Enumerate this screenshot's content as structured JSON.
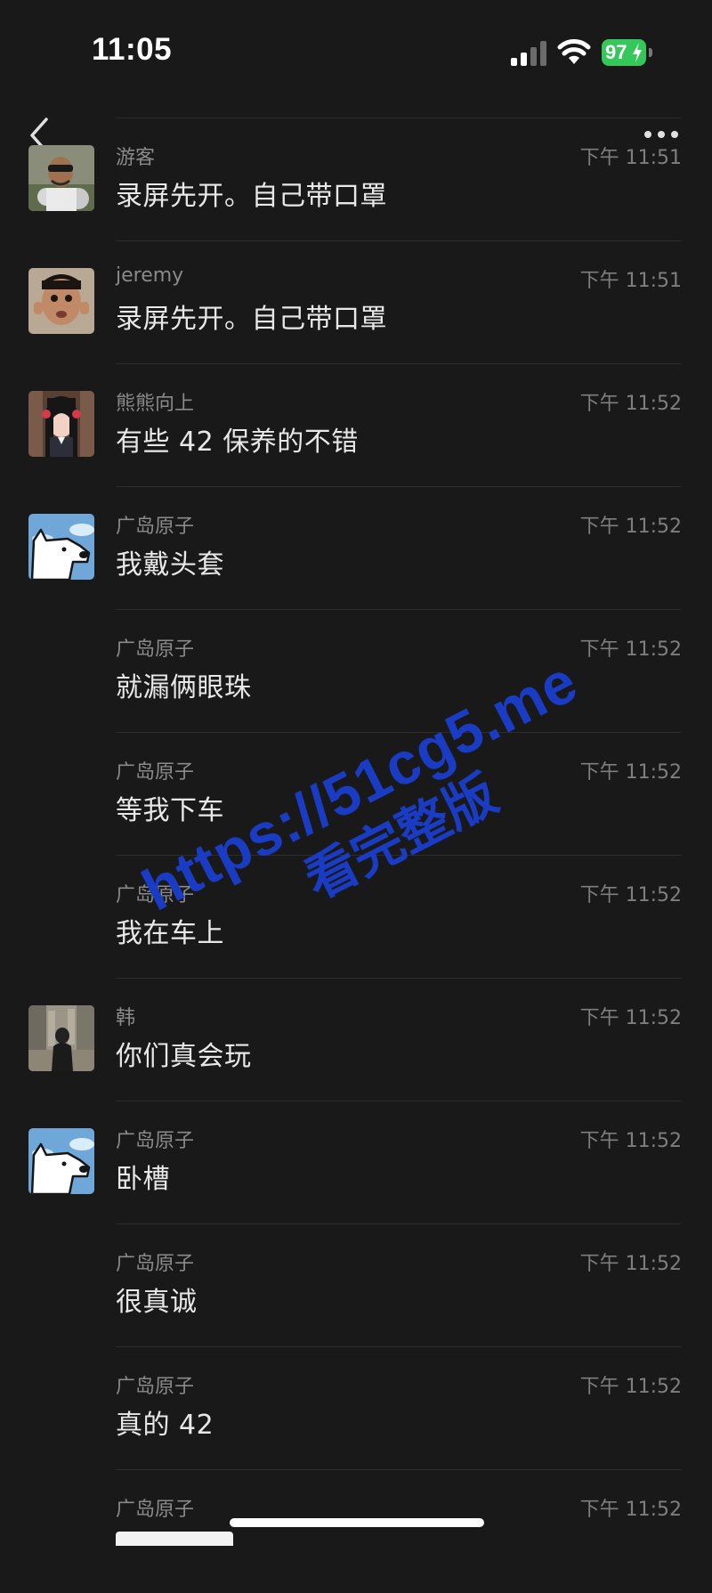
{
  "status_bar": {
    "time": "11:05",
    "battery": "97",
    "icons": [
      "signal-icon",
      "wifi-icon",
      "battery-icon",
      "charging-bolt-icon"
    ]
  },
  "nav": {
    "back_icon": "chevron-left-icon",
    "more_icon": "more-dots-icon"
  },
  "messages": [
    {
      "sender": "游客",
      "time": "下午 11:51",
      "text": "录屏先开。自己带口罩",
      "avatar": "avatar-youke"
    },
    {
      "sender": "jeremy",
      "time": "下午 11:51",
      "text": "录屏先开。自己带口罩",
      "avatar": "avatar-jeremy"
    },
    {
      "sender": "熊熊向上",
      "time": "下午 11:52",
      "text": "有些 42 保养的不错",
      "avatar": "avatar-xiongxiong"
    },
    {
      "sender": "广岛原子",
      "time": "下午 11:52",
      "text": "我戴头套",
      "avatar": "avatar-guangdao-dog"
    },
    {
      "sender": "广岛原子",
      "time": "下午 11:52",
      "text": "就漏俩眼珠",
      "avatar": ""
    },
    {
      "sender": "广岛原子",
      "time": "下午 11:52",
      "text": "等我下车",
      "avatar": ""
    },
    {
      "sender": "广岛原子",
      "time": "下午 11:52",
      "text": "我在车上",
      "avatar": ""
    },
    {
      "sender": "韩",
      "time": "下午 11:52",
      "text": "你们真会玩",
      "avatar": "avatar-han"
    },
    {
      "sender": "广岛原子",
      "time": "下午 11:52",
      "text": "卧槽",
      "avatar": "avatar-guangdao-dog"
    },
    {
      "sender": "广岛原子",
      "time": "下午 11:52",
      "text": "很真诚",
      "avatar": ""
    },
    {
      "sender": "广岛原子",
      "time": "下午 11:52",
      "text": "真的 42",
      "avatar": ""
    },
    {
      "sender": "广岛原子",
      "time": "下午 11:52",
      "text": "",
      "avatar": ""
    }
  ],
  "watermark": {
    "url": "https://51cg5.me",
    "caption": "看完整版",
    "color": "#1a3cc4"
  },
  "colors": {
    "background": "#191919",
    "battery_green": "#35c759",
    "sender_gray": "#8a8a8a",
    "message_text": "#e8e8e8"
  }
}
